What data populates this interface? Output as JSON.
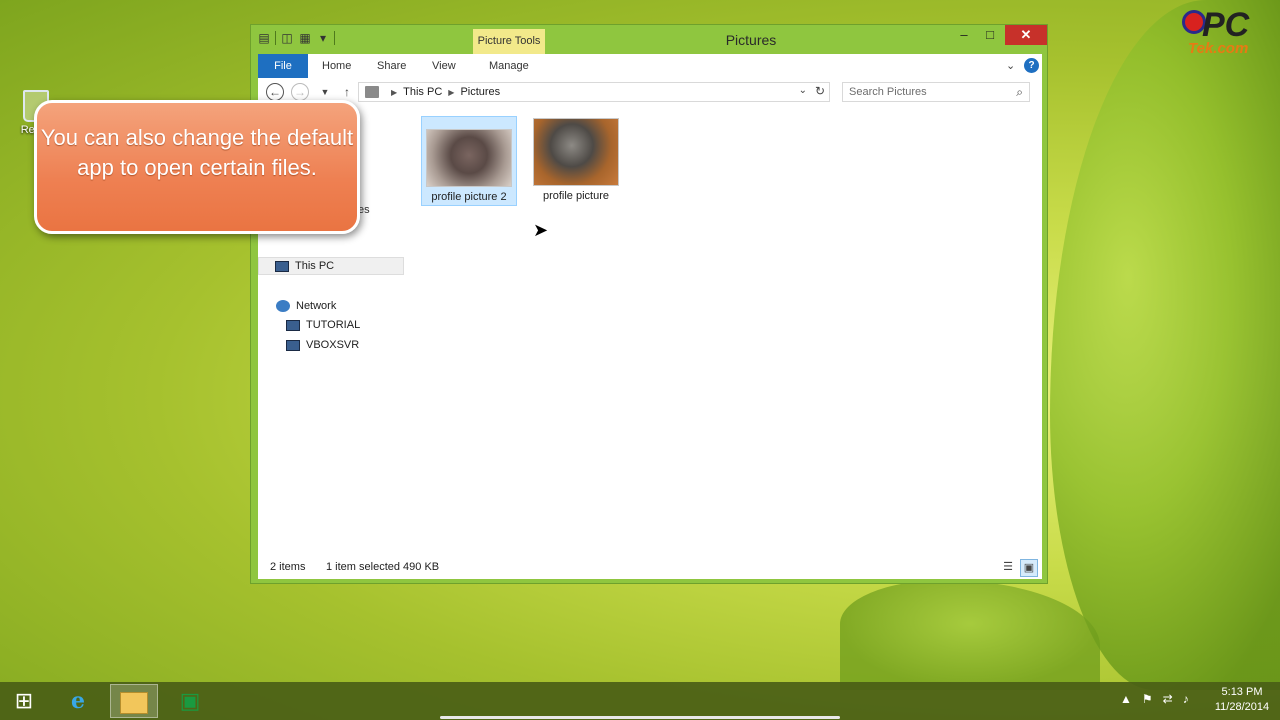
{
  "desktop": {
    "recycle_bin_label": "Recyc",
    "logo_main": "PC",
    "logo_sub": "Tek.com"
  },
  "window": {
    "title": "Pictures",
    "contextual_tab": "Picture Tools",
    "controls": {
      "minimize": "–",
      "maximize": "□",
      "close": "✕"
    }
  },
  "ribbon": {
    "tabs": [
      {
        "label": "File"
      },
      {
        "label": "Home"
      },
      {
        "label": "Share"
      },
      {
        "label": "View"
      },
      {
        "label": "Manage"
      }
    ],
    "help": "?"
  },
  "address_bar": {
    "crumbs": [
      "This PC",
      "Pictures"
    ],
    "search_placeholder": "Search Pictures"
  },
  "nav_pane": {
    "partial_label": "es",
    "this_pc": "This PC",
    "network": "Network",
    "network_children": [
      "TUTORIAL",
      "VBOXSVR"
    ]
  },
  "files": [
    {
      "name": "profile picture 2",
      "selected": true
    },
    {
      "name": "profile picture",
      "selected": false
    }
  ],
  "status_bar": {
    "item_count": "2 items",
    "selection": "1 item selected  490 KB"
  },
  "callout": {
    "text": "You can also change the default app to open certain files."
  },
  "taskbar": {
    "clock_time": "5:13 PM",
    "clock_date": "11/28/2014"
  },
  "colors": {
    "accent": "#1e6fc1",
    "window_frame": "#8fc63f",
    "callout": "#ee8052",
    "close": "#c7312a"
  }
}
